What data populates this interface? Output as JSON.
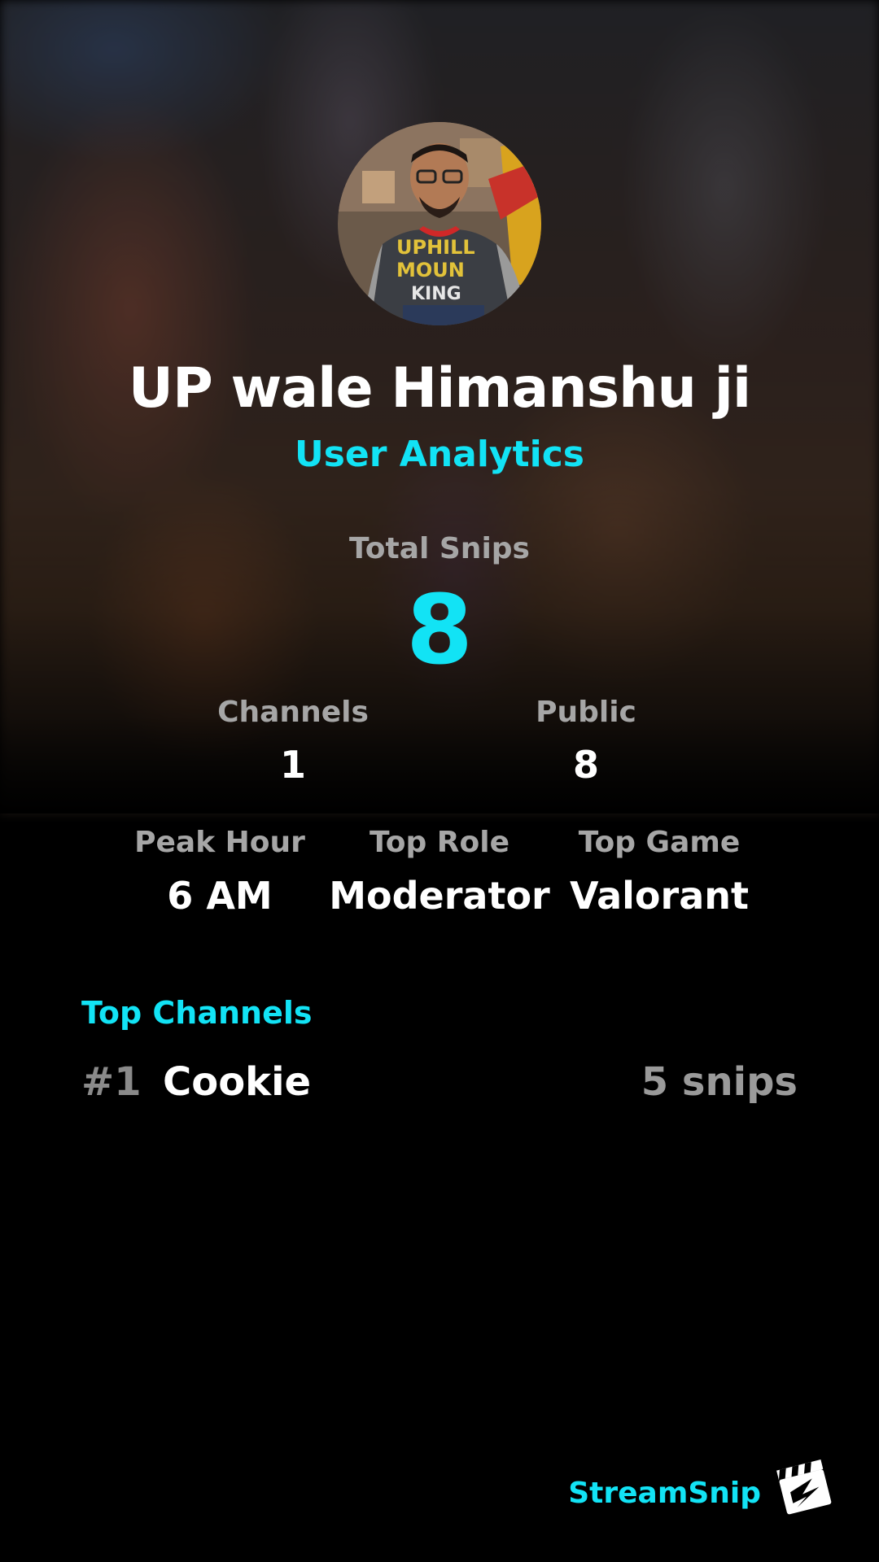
{
  "profile": {
    "name": "UP wale Himanshu ji",
    "subtitle": "User Analytics"
  },
  "totals": {
    "label": "Total Snips",
    "value": "8"
  },
  "stats_row1": [
    {
      "label": "Channels",
      "value": "1"
    },
    {
      "label": "Public",
      "value": "8"
    }
  ],
  "stats_row2": [
    {
      "label": "Peak Hour",
      "value": "6 AM"
    },
    {
      "label": "Top Role",
      "value": "Moderator"
    },
    {
      "label": "Top Game",
      "value": "Valorant"
    }
  ],
  "top_channels": {
    "title": "Top Channels",
    "items": [
      {
        "rank": "#1",
        "name": "Cookie",
        "count": "5 snips"
      }
    ]
  },
  "branding": {
    "name": "StreamSnip",
    "logo_icon": "clapperboard-icon"
  },
  "colors": {
    "accent": "#12e3f5",
    "background": "#000000",
    "muted_text": "#a6a6a6",
    "primary_text": "#ffffff"
  }
}
